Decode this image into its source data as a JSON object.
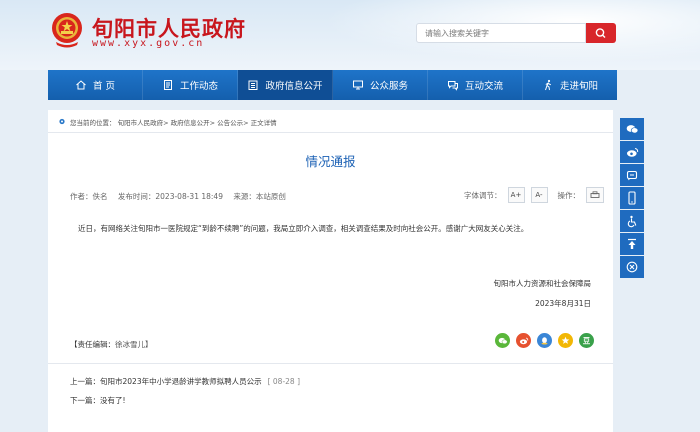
{
  "header": {
    "site_title": "旬阳市人民政府",
    "site_url": "www.xyx.gov.cn",
    "search_placeholder": "请输入搜索关键字"
  },
  "nav": {
    "items": [
      {
        "label": "首 页",
        "icon": "home-icon"
      },
      {
        "label": "工作动态",
        "icon": "document-icon"
      },
      {
        "label": "政府信息公开",
        "icon": "building-icon"
      },
      {
        "label": "公众服务",
        "icon": "monitor-icon"
      },
      {
        "label": "互动交流",
        "icon": "chat-icon"
      },
      {
        "label": "走进旬阳",
        "icon": "walk-icon"
      }
    ],
    "active_index": 2
  },
  "breadcrumb": "您当前的位置： 旬阳市人民政府> 政府信息公开> 公告公示> 正文详情",
  "article": {
    "title": "情况通报",
    "author": "作者：佚名",
    "published": "发布时间：2023-08-31 18:49",
    "source": "来源：本站原创",
    "font_label": "字体调节：",
    "font_increase": "A+",
    "font_decrease": "A-",
    "action_label": "操作：",
    "body": "近日，有网络关注旬阳市一医院规定“到龄不续聘”的问题，我局立即介入调查，相关调查结果及时向社会公开。感谢广大网友关心关注。",
    "signature_org": "旬阳市人力资源和社会保障局",
    "signature_date": "2023年8月31日",
    "editor_label": "【责任编辑：",
    "editor_name": "徐冰雪儿】"
  },
  "pager": {
    "prev_label": "上一篇：",
    "prev_title": "旬阳市2023年中小学退龄讲学教师拟聘人员公示",
    "prev_date": "[ 08-28 ]",
    "next_label": "下一篇：",
    "next_title": "没有了!"
  },
  "colors": {
    "brand_red": "#c8161d",
    "nav_blue": "#1f74c9",
    "title_blue": "#1d62b5"
  }
}
